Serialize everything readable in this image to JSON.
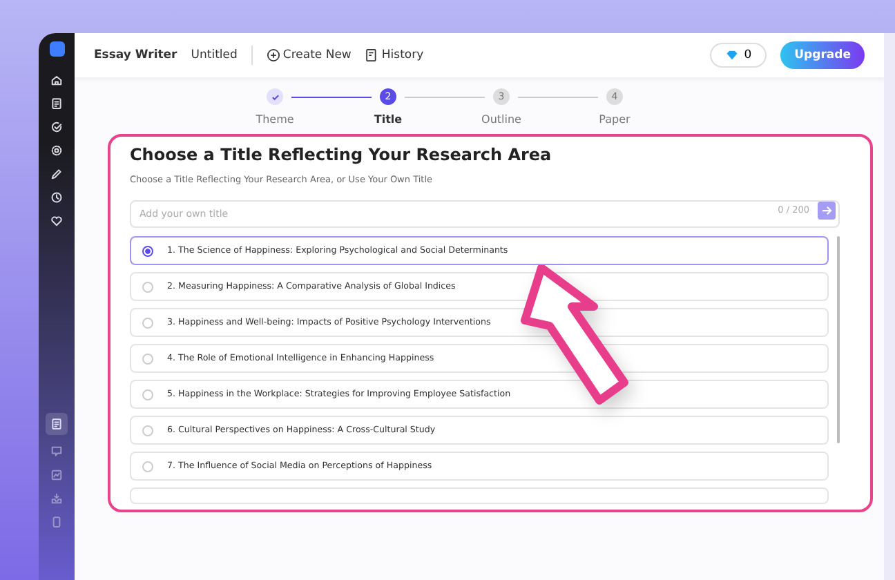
{
  "topbar": {
    "app_name": "Essay Writer",
    "doc_name": "Untitled",
    "actions": [
      {
        "kind": "create",
        "label": "Create New"
      },
      {
        "kind": "history",
        "label": "History"
      }
    ],
    "credits": "0",
    "upgrade": "Upgrade"
  },
  "sidebar": {
    "top_items": [
      {
        "kind": "home"
      },
      {
        "kind": "doc"
      },
      {
        "kind": "check"
      },
      {
        "kind": "gear"
      },
      {
        "kind": "pencil"
      },
      {
        "kind": "clock"
      },
      {
        "kind": "heart"
      }
    ],
    "bottom_items": [
      {
        "kind": "doc",
        "selected": true
      },
      {
        "kind": "chat",
        "selected": false
      },
      {
        "kind": "chart",
        "selected": false
      },
      {
        "kind": "inbox",
        "selected": false
      },
      {
        "kind": "phone",
        "selected": false
      }
    ]
  },
  "steps": [
    {
      "label": "Theme",
      "done": true,
      "selected": false
    },
    {
      "label": "Title",
      "number": "2",
      "done": false,
      "selected": true
    },
    {
      "label": "Outline",
      "number": "3",
      "done": false,
      "selected": false
    },
    {
      "label": "Paper",
      "number": "4",
      "done": false,
      "selected": false
    }
  ],
  "card": {
    "title": "Choose a Title Reflecting Your Research Area",
    "subtitle": "Choose a Title Reflecting Your Research Area, or Use Your Own Title",
    "input": {
      "placeholder": "Add your own title",
      "counter": "0 / 200"
    },
    "options": [
      {
        "label": "1. The Science of Happiness: Exploring Psychological and Social Determinants",
        "selected": true
      },
      {
        "label": "2. Measuring Happiness: A Comparative Analysis of Global Indices",
        "selected": false
      },
      {
        "label": "3. Happiness and Well-being: Impacts of Positive Psychology Interventions",
        "selected": false
      },
      {
        "label": "4. The Role of Emotional Intelligence in Enhancing Happiness",
        "selected": false
      },
      {
        "label": "5. Happiness in the Workplace: Strategies for Improving Employee Satisfaction",
        "selected": false
      },
      {
        "label": "6. Cultural Perspectives on Happiness: A Cross-Cultural Study",
        "selected": false
      },
      {
        "label": "7. The Influence of Social Media on Perceptions of Happiness",
        "selected": false
      }
    ]
  }
}
